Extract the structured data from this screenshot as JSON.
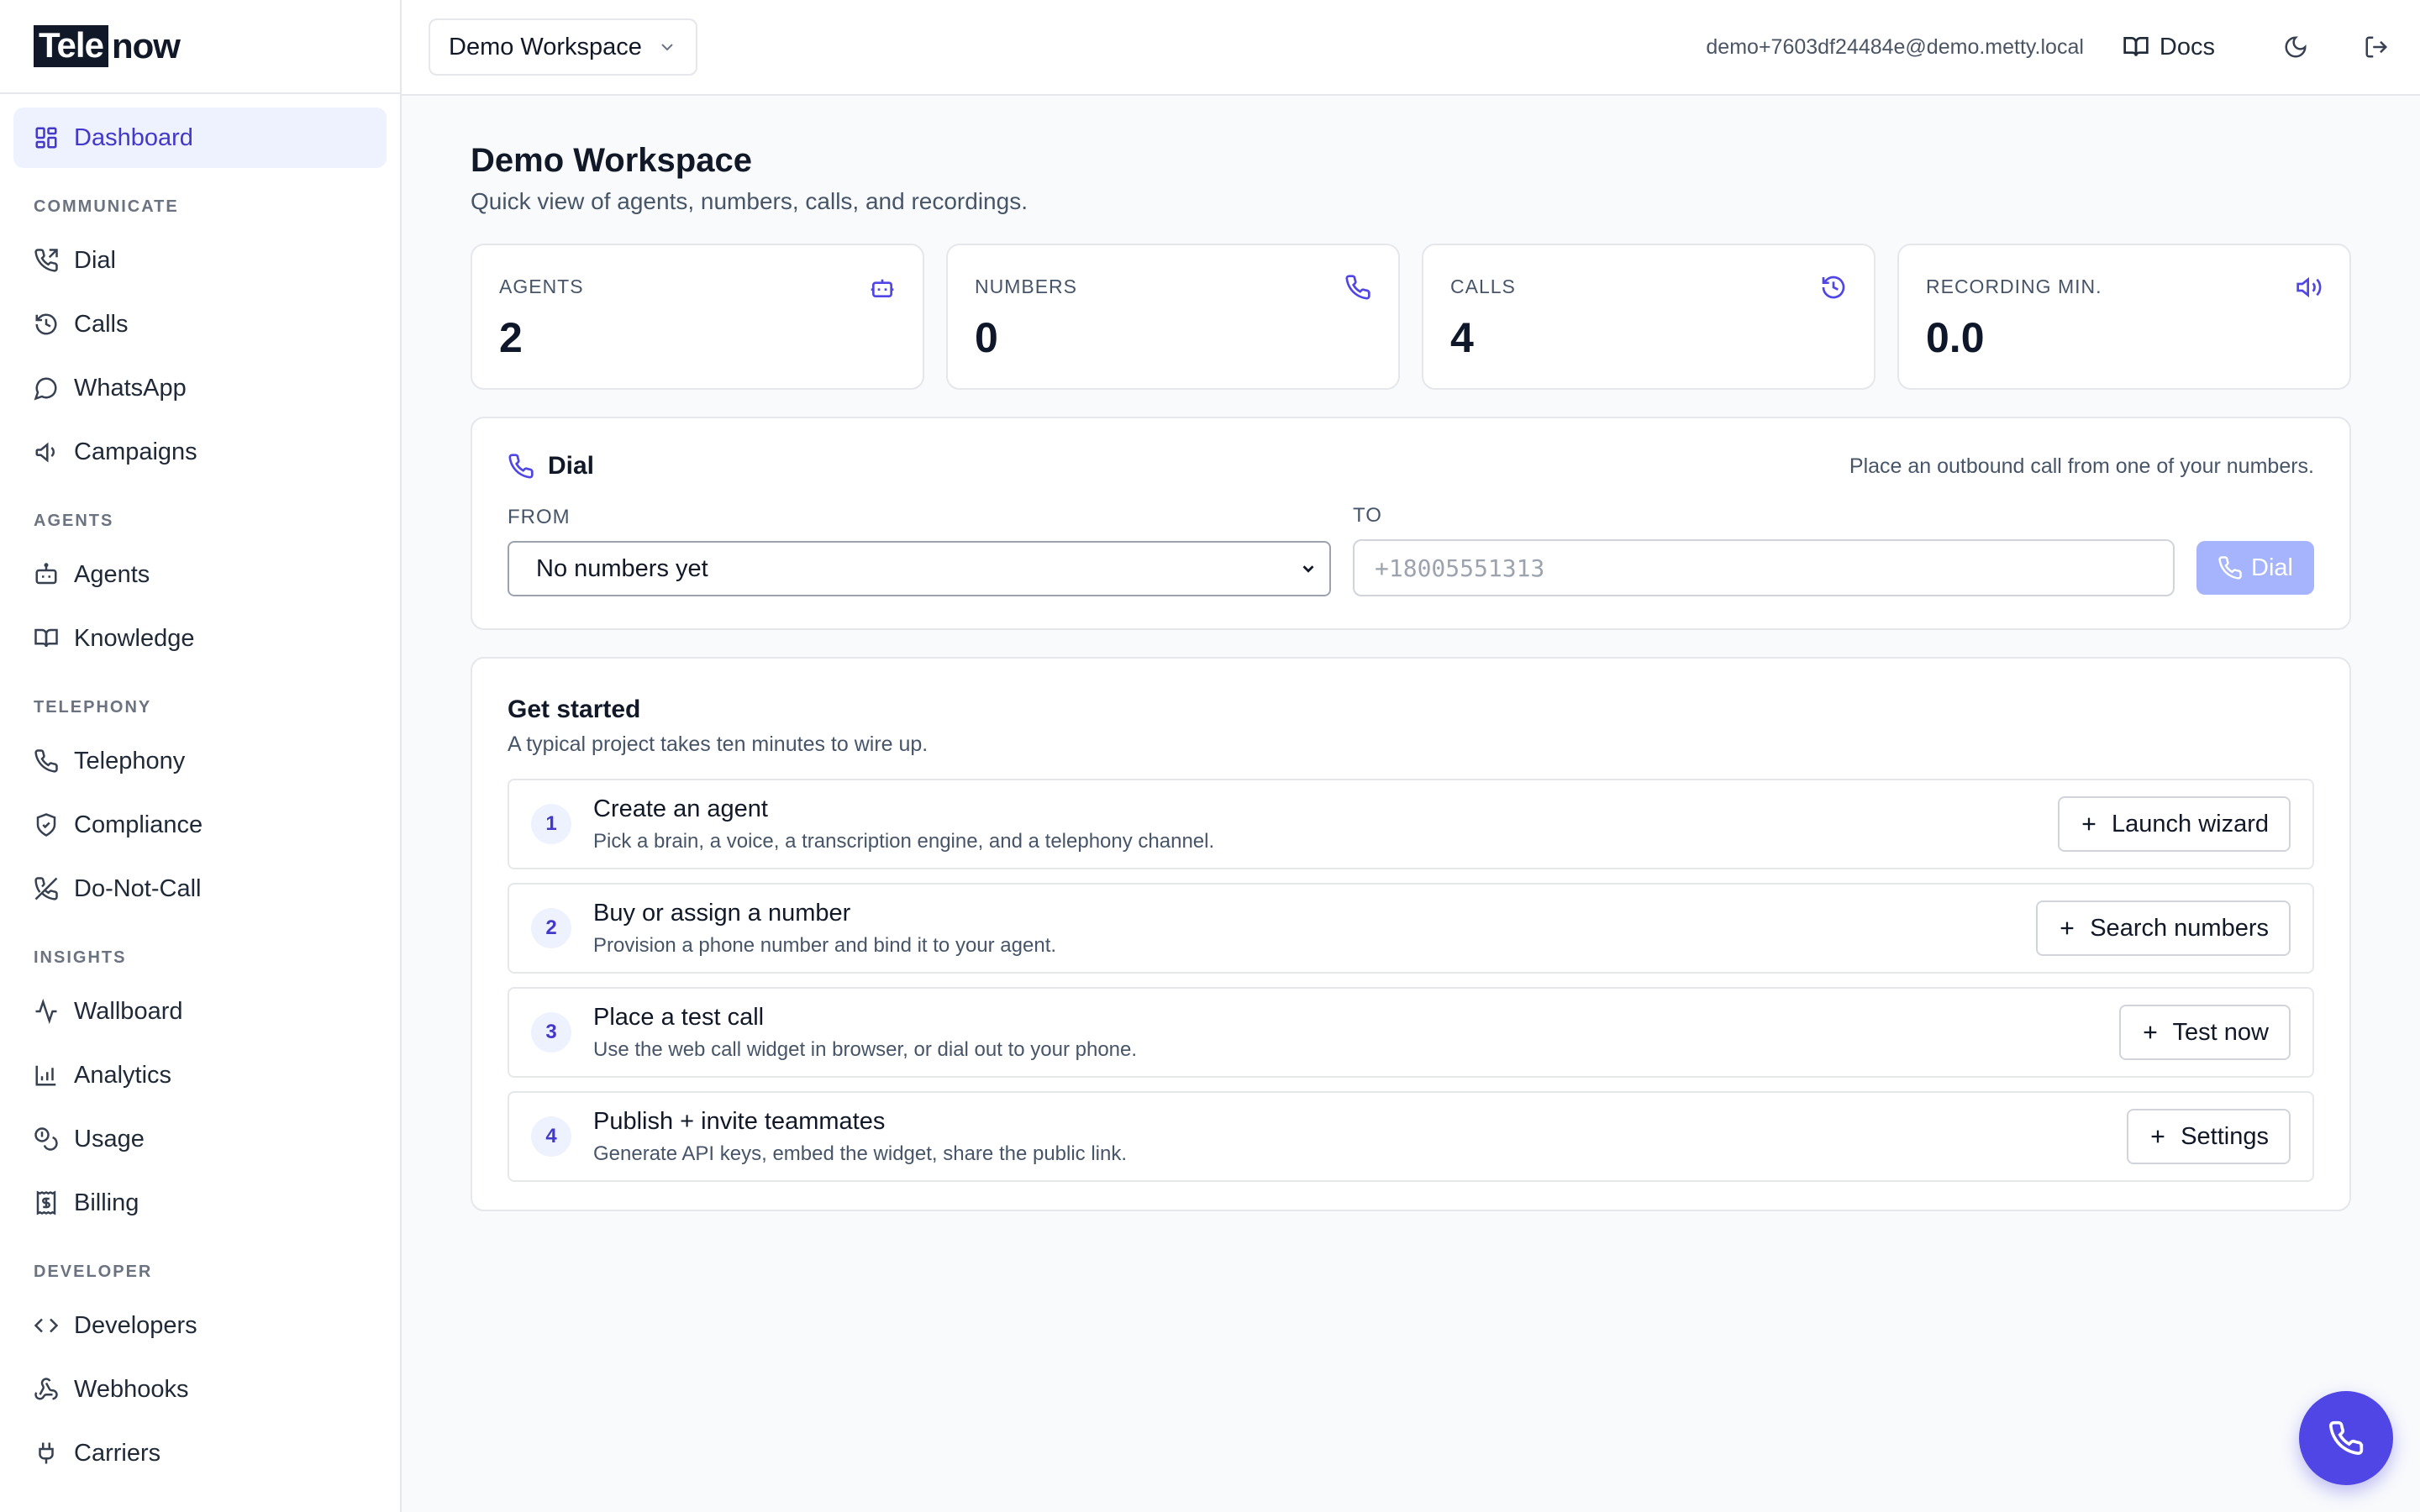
{
  "brand": {
    "part1": "Tele",
    "part2": "now"
  },
  "sidebar": {
    "dashboard": "Dashboard",
    "sections": {
      "communicate": "COMMUNICATE",
      "agents": "AGENTS",
      "telephony": "TELEPHONY",
      "insights": "INSIGHTS",
      "developer": "DEVELOPER"
    },
    "items": {
      "dial": "Dial",
      "calls": "Calls",
      "whatsapp": "WhatsApp",
      "campaigns": "Campaigns",
      "agents": "Agents",
      "knowledge": "Knowledge",
      "telephony": "Telephony",
      "compliance": "Compliance",
      "dnc": "Do-Not-Call",
      "wallboard": "Wallboard",
      "analytics": "Analytics",
      "usage": "Usage",
      "billing": "Billing",
      "developers": "Developers",
      "webhooks": "Webhooks",
      "carriers": "Carriers"
    }
  },
  "topbar": {
    "workspace": "Demo Workspace",
    "email": "demo+7603df24484e@demo.metty.local",
    "docs": "Docs"
  },
  "page": {
    "title": "Demo Workspace",
    "subtitle": "Quick view of agents, numbers, calls, and recordings."
  },
  "stats": {
    "agents": {
      "label": "AGENTS",
      "value": "2"
    },
    "numbers": {
      "label": "NUMBERS",
      "value": "0"
    },
    "calls": {
      "label": "CALLS",
      "value": "4"
    },
    "recording": {
      "label": "RECORDING MIN.",
      "value": "0.0"
    }
  },
  "dial": {
    "title": "Dial",
    "note": "Place an outbound call from one of your numbers.",
    "from_label": "FROM",
    "from_value": "No numbers yet",
    "to_label": "TO",
    "to_placeholder": "+18005551313",
    "button": "Dial"
  },
  "get_started": {
    "title": "Get started",
    "subtitle": "A typical project takes ten minutes to wire up.",
    "steps": [
      {
        "num": "1",
        "title": "Create an agent",
        "desc": "Pick a brain, a voice, a transcription engine, and a telephony channel.",
        "button": "Launch wizard"
      },
      {
        "num": "2",
        "title": "Buy or assign a number",
        "desc": "Provision a phone number and bind it to your agent.",
        "button": "Search numbers"
      },
      {
        "num": "3",
        "title": "Place a test call",
        "desc": "Use the web call widget in browser, or dial out to your phone.",
        "button": "Test now"
      },
      {
        "num": "4",
        "title": "Publish + invite teammates",
        "desc": "Generate API keys, embed the widget, share the public link.",
        "button": "Settings"
      }
    ]
  },
  "colors": {
    "accent": "#4f46e5",
    "accent_soft": "#eef2ff",
    "dial_disabled": "#a5b4fc"
  }
}
